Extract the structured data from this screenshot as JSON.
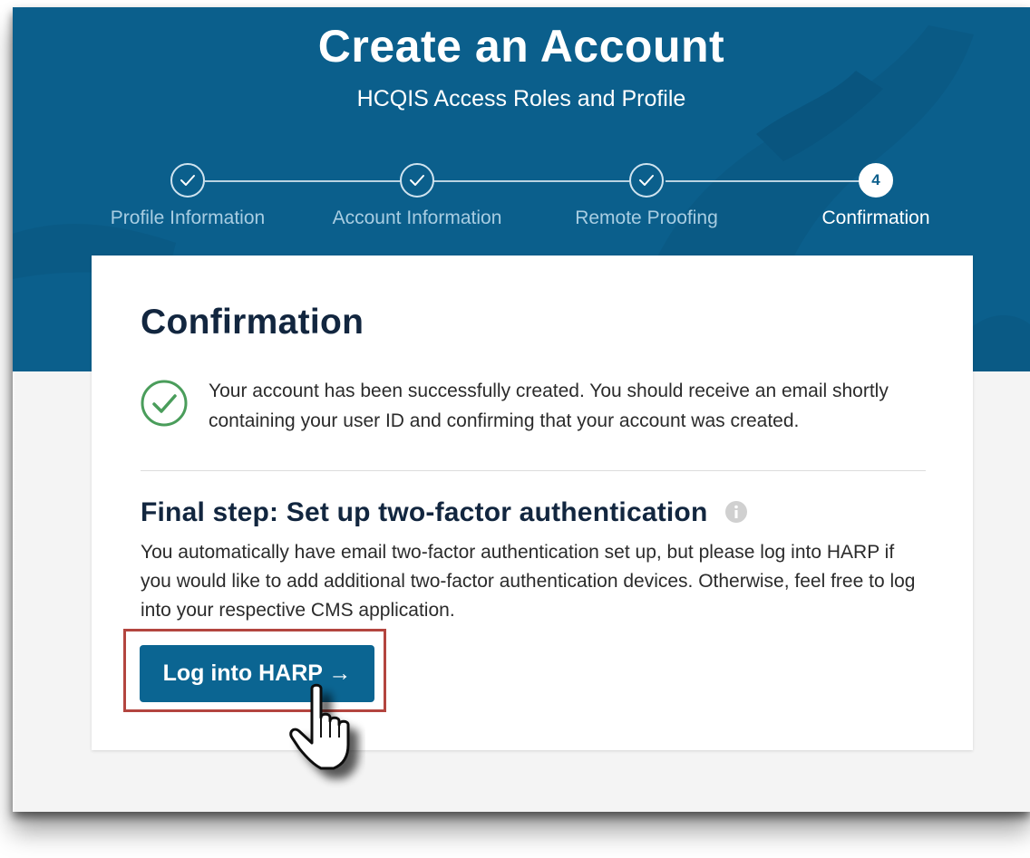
{
  "header": {
    "title": "Create an Account",
    "subtitle": "HCQIS Access Roles and Profile"
  },
  "steps": [
    {
      "label": "Profile Information",
      "status": "complete",
      "icon": "check-icon"
    },
    {
      "label": "Account Information",
      "status": "complete",
      "icon": "check-icon"
    },
    {
      "label": "Remote Proofing",
      "status": "complete",
      "icon": "check-icon"
    },
    {
      "label": "Confirmation",
      "status": "current",
      "number": "4"
    }
  ],
  "card": {
    "title": "Confirmation",
    "success_message": "Your account has been successfully created. You should receive an email shortly containing your user ID and confirming that your account was created.",
    "final_step_heading": "Final step: Set up two-factor authentication",
    "final_step_text": "You automatically have email two-factor authentication set up, but please log into HARP if you would like to add additional two-factor authentication devices. Otherwise, feel free to log into your respective CMS application.",
    "button_label": "Log into HARP →"
  },
  "colors": {
    "hero_blue": "#0b5f8c",
    "button_blue": "#0b6592",
    "heading_navy": "#12263f",
    "success_green": "#4a9d5b",
    "highlight_red": "#b3453f"
  }
}
